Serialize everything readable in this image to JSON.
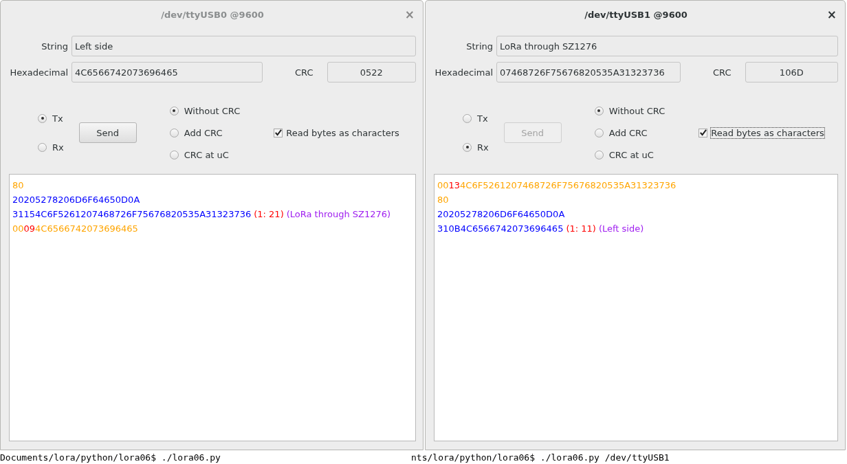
{
  "windows": [
    {
      "title": "/dev/ttyUSB0 @9600",
      "active": false,
      "close": "×",
      "string_label": "String",
      "string_value": "Left side",
      "hex_label": "Hexadecimal",
      "hex_value": "4C6566742073696465",
      "crc_label": "CRC",
      "crc_value": "0522",
      "direction": [
        {
          "label": "Tx",
          "selected": true
        },
        {
          "label": "Rx",
          "selected": false
        }
      ],
      "send": {
        "label": "Send",
        "disabled": false
      },
      "crc_modes": [
        {
          "label": "Without CRC",
          "selected": true
        },
        {
          "label": "Add CRC",
          "selected": false
        },
        {
          "label": "CRC at uC",
          "selected": false
        }
      ],
      "read_chars": {
        "label": "Read bytes as characters",
        "checked": true,
        "focused": false
      },
      "log": [
        [
          {
            "text": "80",
            "color": "#ffa500"
          }
        ],
        [
          {
            "text": "20205278206D6F64650D0A",
            "color": "#0000ff"
          }
        ],
        [
          {
            "text": "31154C6F5261207468726F75676820535A31323736",
            "color": "#0000ff"
          },
          {
            "text": "(1: 21)",
            "color": "#ff0000",
            "space_before": true
          },
          {
            "text": "(LoRa through SZ1276)",
            "color": "#a020f0",
            "space_before": true
          }
        ],
        [
          {
            "text": "00",
            "color": "#ffa500"
          },
          {
            "text": "09",
            "color": "#ff0000"
          },
          {
            "text": "4C6566742073696465",
            "color": "#ffa500"
          }
        ]
      ]
    },
    {
      "title": "/dev/ttyUSB1 @9600",
      "active": true,
      "close": "×",
      "string_label": "String",
      "string_value": "LoRa through SZ1276",
      "hex_label": "Hexadecimal",
      "hex_value": "07468726F75676820535A31323736",
      "crc_label": "CRC",
      "crc_value": "106D",
      "direction": [
        {
          "label": "Tx",
          "selected": false
        },
        {
          "label": "Rx",
          "selected": true
        }
      ],
      "send": {
        "label": "Send",
        "disabled": true
      },
      "crc_modes": [
        {
          "label": "Without CRC",
          "selected": true
        },
        {
          "label": "Add CRC",
          "selected": false
        },
        {
          "label": "CRC at uC",
          "selected": false
        }
      ],
      "read_chars": {
        "label": "Read bytes as characters",
        "checked": true,
        "focused": true
      },
      "log": [
        [
          {
            "text": "00",
            "color": "#ffa500"
          },
          {
            "text": "13",
            "color": "#ff0000"
          },
          {
            "text": "4C6F5261207468726F75676820535A31323736",
            "color": "#ffa500"
          }
        ],
        [
          {
            "text": "80",
            "color": "#ffa500"
          }
        ],
        [
          {
            "text": "20205278206D6F64650D0A",
            "color": "#0000ff"
          }
        ],
        [
          {
            "text": "310B4C6566742073696465",
            "color": "#0000ff"
          },
          {
            "text": "(1: 11)",
            "color": "#ff0000",
            "space_before": true
          },
          {
            "text": "(Left side)",
            "color": "#a020f0",
            "space_before": true
          }
        ]
      ]
    }
  ],
  "terminal": [
    "Documents/lora/python/lora06$ ./lora06.py",
    "nts/lora/python/lora06$ ./lora06.py /dev/ttyUSB1"
  ]
}
